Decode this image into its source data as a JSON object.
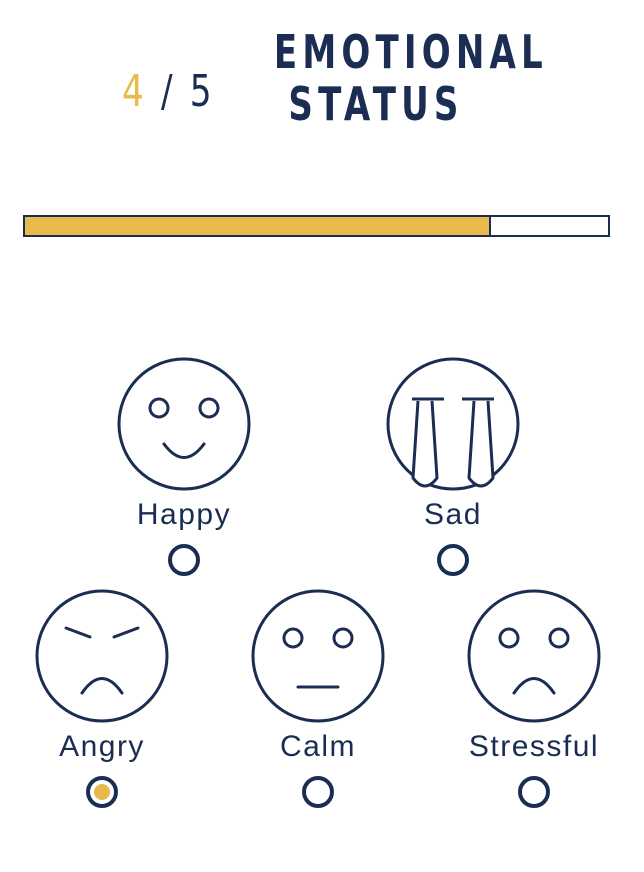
{
  "header": {
    "step_current": "4",
    "step_separator": "/",
    "step_total": "5",
    "title_line1": "EMOTIONAL",
    "title_line2": "STATUS"
  },
  "progress": {
    "fraction": 0.8
  },
  "options": [
    {
      "id": "happy",
      "label": "Happy",
      "icon": "happy-face-icon",
      "selected": false
    },
    {
      "id": "sad",
      "label": "Sad",
      "icon": "sad-crying-face-icon",
      "selected": false
    },
    {
      "id": "angry",
      "label": "Angry",
      "icon": "angry-face-icon",
      "selected": true
    },
    {
      "id": "calm",
      "label": "Calm",
      "icon": "calm-face-icon",
      "selected": false
    },
    {
      "id": "stressful",
      "label": "Stressful",
      "icon": "stressful-face-icon",
      "selected": false
    }
  ],
  "colors": {
    "navy": "#1b2d52",
    "accent": "#e8b94b",
    "background": "#ffffff"
  }
}
